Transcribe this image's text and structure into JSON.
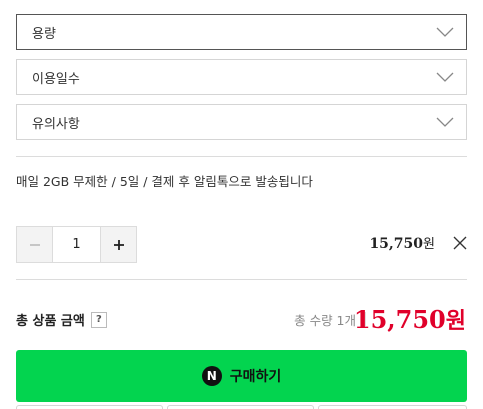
{
  "selects": [
    {
      "label": "용량"
    },
    {
      "label": "이용일수"
    },
    {
      "label": "유의사항"
    }
  ],
  "selected_option": {
    "description": "매일 2GB 무제한 / 5일 / 결제 후 알림톡으로 발송됩니다",
    "quantity": "1",
    "price": "15,750",
    "currency": "원"
  },
  "total": {
    "label": "총 상품 금액",
    "help": "?",
    "quantity_text": "총 수량 1개",
    "price": "15,750",
    "currency": "원"
  },
  "buy_button": {
    "icon_letter": "N",
    "label": "구매하기",
    "color": "#03d44f"
  },
  "accent_price_color": "#e0002a"
}
